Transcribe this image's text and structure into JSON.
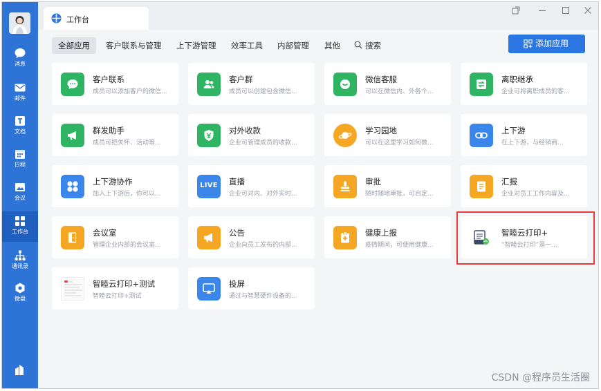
{
  "window": {
    "tab_title": "工作台"
  },
  "sidebar": {
    "items": [
      {
        "label": "消息",
        "icon": "chat-icon"
      },
      {
        "label": "邮件",
        "icon": "mail-icon"
      },
      {
        "label": "文档",
        "icon": "document-icon"
      },
      {
        "label": "日程",
        "icon": "calendar-icon"
      },
      {
        "label": "会议",
        "icon": "meeting-icon"
      },
      {
        "label": "工作台",
        "icon": "grid-icon",
        "active": true
      },
      {
        "label": "通讯录",
        "icon": "org-icon"
      },
      {
        "label": "微盘",
        "icon": "drive-icon"
      }
    ]
  },
  "filters": [
    "全部应用",
    "客户联系与管理",
    "上下游管理",
    "效率工具",
    "内部管理",
    "其他",
    "搜索"
  ],
  "add_app_label": "添加应用",
  "apps": [
    {
      "name": "客户联系",
      "desc": "成员可以添加客户的微信...",
      "color": "#2fb463"
    },
    {
      "name": "客户群",
      "desc": "成员可以创建包含微信...",
      "color": "#2fb463"
    },
    {
      "name": "微信客服",
      "desc": "可以在微信内、外各个...",
      "color": "#2fb463"
    },
    {
      "name": "离职继承",
      "desc": "企业可将离职成员的客...",
      "color": "#2fb463"
    },
    {
      "name": "群发助手",
      "desc": "成员可把关怀、活动等...",
      "color": "#2fb463"
    },
    {
      "name": "对外收款",
      "desc": "企业可管理成员的收款...",
      "color": "#2fb463"
    },
    {
      "name": "学习园地",
      "desc": "可以在这里学习如何做...",
      "color": "#f5a623"
    },
    {
      "name": "上下游",
      "desc": "在上下游，与经销商...",
      "color": "#3b86ea"
    },
    {
      "name": "上下游协作",
      "desc": "加入上下游后，你可以...",
      "color": "#3b86ea"
    },
    {
      "name": "直播",
      "desc": "企业可对内、对外实时...",
      "color": "#3b86ea"
    },
    {
      "name": "审批",
      "desc": "随时随地审批，可自定...",
      "color": "#f5a623"
    },
    {
      "name": "汇报",
      "desc": "企业对员工工作内容及...",
      "color": "#f5a623"
    },
    {
      "name": "会议室",
      "desc": "管理企业内部的会议室...",
      "color": "#f5a623"
    },
    {
      "name": "公告",
      "desc": "企业向员工发布的内部...",
      "color": "#f5a623"
    },
    {
      "name": "健康上报",
      "desc": "疫情期间，可使用健康...",
      "color": "#f5a623"
    },
    {
      "name": "智睦云打印+",
      "desc": "“智睦云打印”是一...",
      "color": "#ffffff"
    },
    {
      "name": "智睦云打印+测试",
      "desc": "智睦云打印+测试",
      "color": "#ffffff"
    },
    {
      "name": "投屏",
      "desc": "通过与智慧硬件设备的...",
      "color": "#3b86ea"
    }
  ],
  "live_label": "LIVE",
  "watermark": "CSDN @程序员生活圈"
}
